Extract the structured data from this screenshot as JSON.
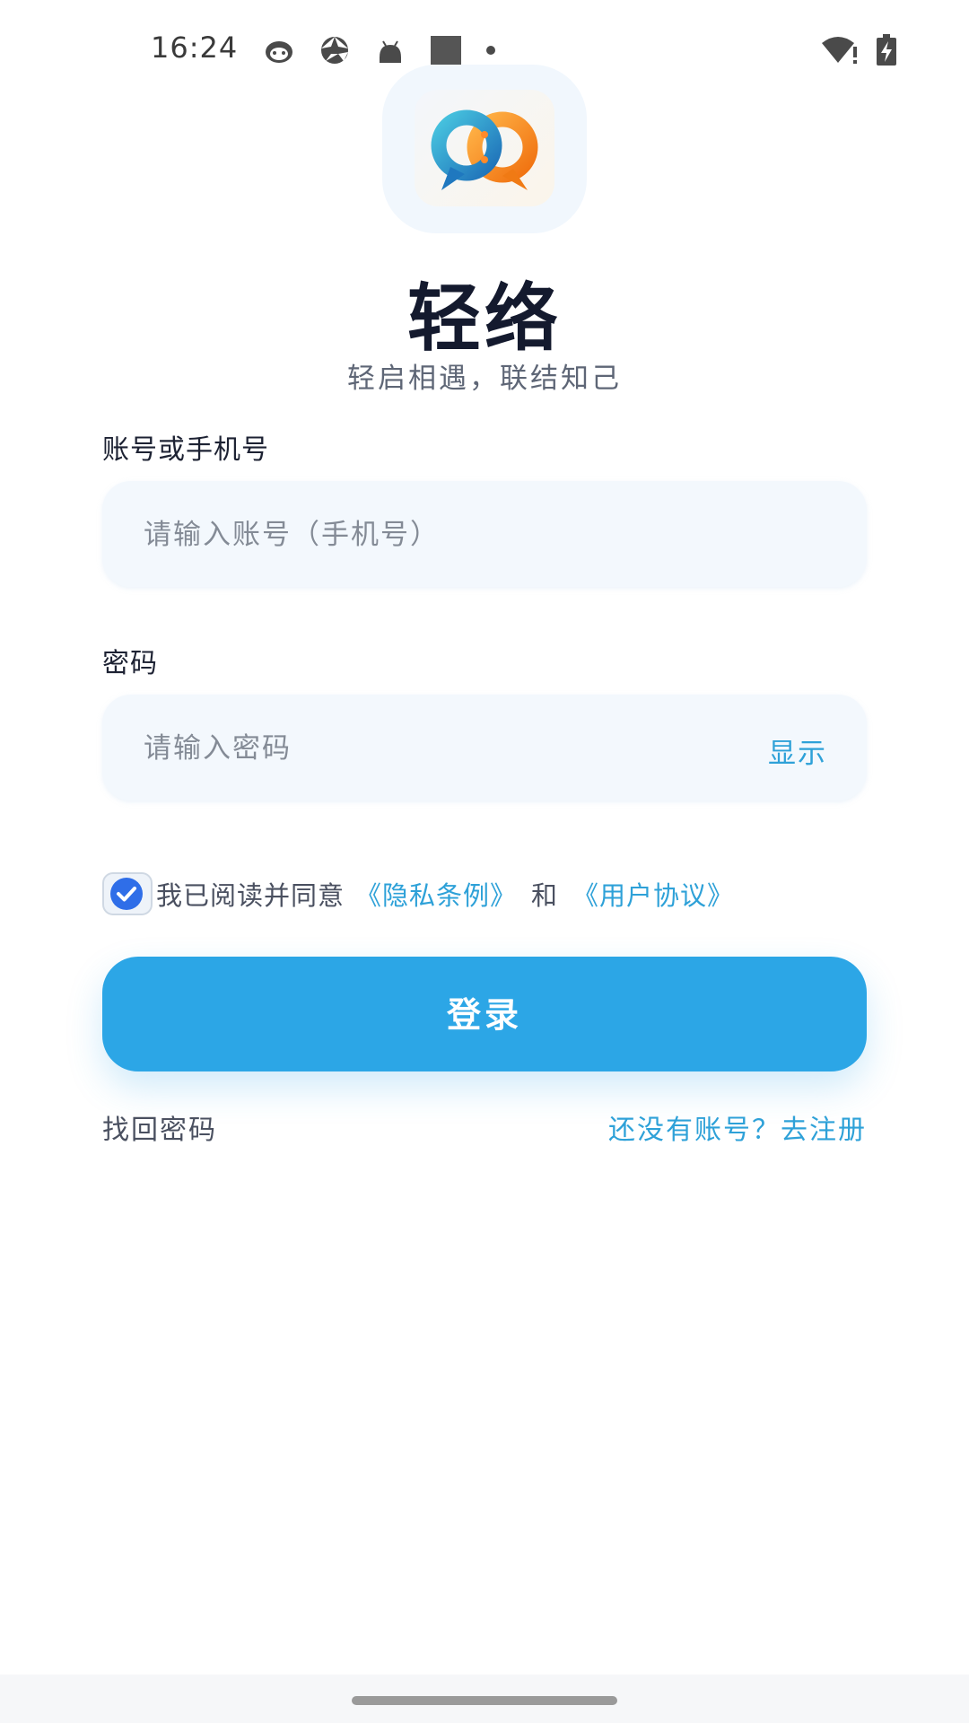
{
  "status_bar": {
    "time": "16:24",
    "left_icons": [
      "cat-face-icon",
      "aperture-icon",
      "android-icon",
      "square-icon",
      "dot-icon"
    ],
    "right_icons": [
      "wifi-alert-icon",
      "battery-charging-icon"
    ]
  },
  "app": {
    "name": "轻络",
    "slogan": "轻启相遇，联结知己"
  },
  "account_field": {
    "label": "账号或手机号",
    "placeholder": "请输入账号（手机号）",
    "value": ""
  },
  "password_field": {
    "label": "密码",
    "placeholder": "请输入密码",
    "value": "",
    "toggle_label": "显示"
  },
  "agreement": {
    "checked": true,
    "prefix": "我已阅读并同意",
    "privacy_link": "《隐私条例》",
    "and": "和",
    "terms_link": "《用户协议》"
  },
  "login_button": {
    "label": "登录"
  },
  "links": {
    "forgot": "找回密码",
    "register": "还没有账号？去注册"
  },
  "colors": {
    "accent": "#2ca6e6",
    "link": "#2ea1d8",
    "title": "#141a2e",
    "input_bg": "#f3f8fd"
  }
}
